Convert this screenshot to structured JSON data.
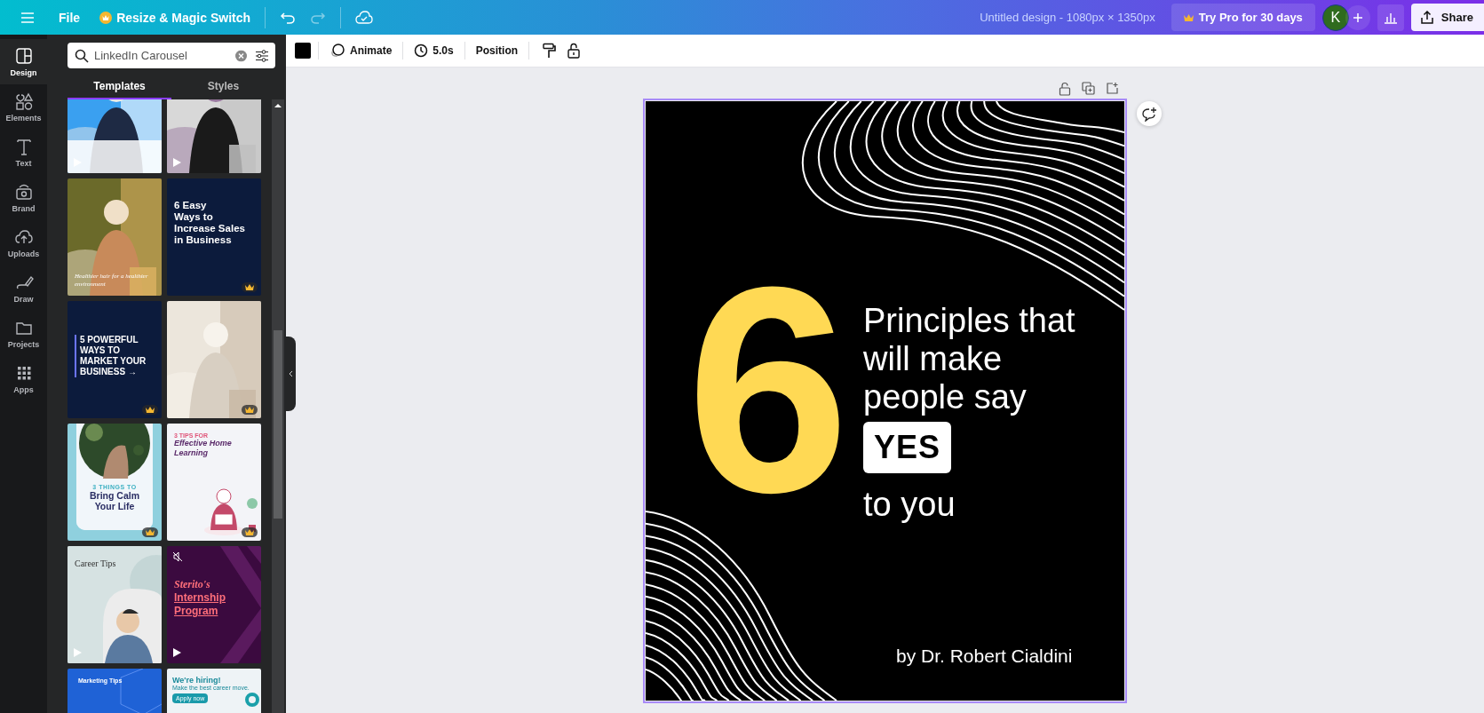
{
  "top_bar": {
    "file": "File",
    "resize": "Resize & Magic Switch",
    "title": "Untitled design - 1080px × 1350px",
    "try_pro": "Try Pro for 30 days",
    "avatar": "K",
    "share": "Share"
  },
  "toolbar": {
    "animate": "Animate",
    "duration": "5.0s",
    "position": "Position"
  },
  "rail": [
    {
      "label": "Design",
      "selected": true
    },
    {
      "label": "Elements",
      "selected": false
    },
    {
      "label": "Text",
      "selected": false
    },
    {
      "label": "Brand",
      "selected": false
    },
    {
      "label": "Uploads",
      "selected": false
    },
    {
      "label": "Draw",
      "selected": false
    },
    {
      "label": "Projects",
      "selected": false
    },
    {
      "label": "Apps",
      "selected": false
    }
  ],
  "panel": {
    "search": {
      "value": "LinkedIn Carousel"
    },
    "tabs": [
      {
        "label": "Templates",
        "selected": true
      },
      {
        "label": "Styles",
        "selected": false
      }
    ],
    "templates": [
      {
        "kind": "nurse",
        "play": true
      },
      {
        "kind": "portrait",
        "play": true
      },
      {
        "kind": "hair",
        "caption": "Healthier hair for a healthier environment"
      },
      {
        "kind": "navy",
        "lines": [
          "**6** Easy",
          "Ways to",
          "**Increase Sales**",
          "in Business"
        ],
        "premium": true
      },
      {
        "kind": "marketing",
        "lines": [
          "**5 POWERFUL**",
          "WAYS TO",
          "MARKET YOUR",
          "BUSINESS →"
        ],
        "premium": true
      },
      {
        "kind": "fashion",
        "premium": true
      },
      {
        "kind": "calm",
        "kicker": "3 THINGS TO",
        "lines": [
          "Bring Calm",
          "Your Life"
        ],
        "premium": true
      },
      {
        "kind": "learning",
        "kicker": "3 TIPS FOR",
        "lines": [
          "Effective Home",
          "Learning"
        ],
        "premium": true
      },
      {
        "kind": "career",
        "lines": [
          "Career Tips"
        ],
        "play": true
      },
      {
        "kind": "internship",
        "lines": [
          "Sterito's",
          "Internship",
          "Program"
        ],
        "play": true,
        "muted": true
      },
      {
        "kind": "blue",
        "kicker": "Marketing Tips"
      },
      {
        "kind": "hiring",
        "lines": [
          "We're hiring!"
        ],
        "kicker": "Make the best career move.",
        "button": "Apply now"
      }
    ]
  },
  "design": {
    "number": "6",
    "lines": [
      "Principles that",
      "will make",
      "people say"
    ],
    "badge": "YES",
    "tail": "to you",
    "byline": "by Dr. Robert Cialdini"
  }
}
